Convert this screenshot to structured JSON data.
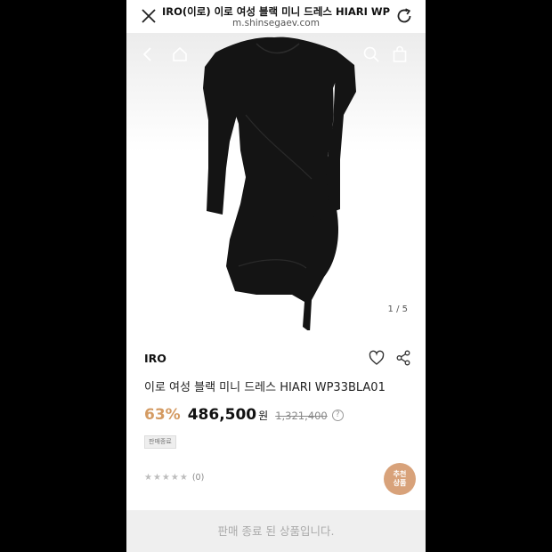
{
  "browser": {
    "page_title": "IRO(이로) 이로 여성 블랙 미니 드레스 HIARI WP33...",
    "domain": "m.shinsegaev.com"
  },
  "gallery": {
    "counter": "1 / 5",
    "image_icon": "black-long-sleeve-mini-dress"
  },
  "product": {
    "brand": "IRO",
    "title": "이로 여성 블랙 미니 드레스 HIARI WP33BLA01",
    "discount": "63%",
    "price": "486,500",
    "currency": "원",
    "original_price": "1,321,400",
    "help": "?",
    "badge": "판매종료",
    "stars": "★★★★★",
    "review_count": "(0)"
  },
  "recommend_button": {
    "line1": "추천",
    "line2": "상품"
  },
  "bottom_bar": {
    "status": "판매 종료 된 상품입니다."
  },
  "colors": {
    "accent": "#d49b63",
    "recommend_bg": "#d8a27a"
  }
}
